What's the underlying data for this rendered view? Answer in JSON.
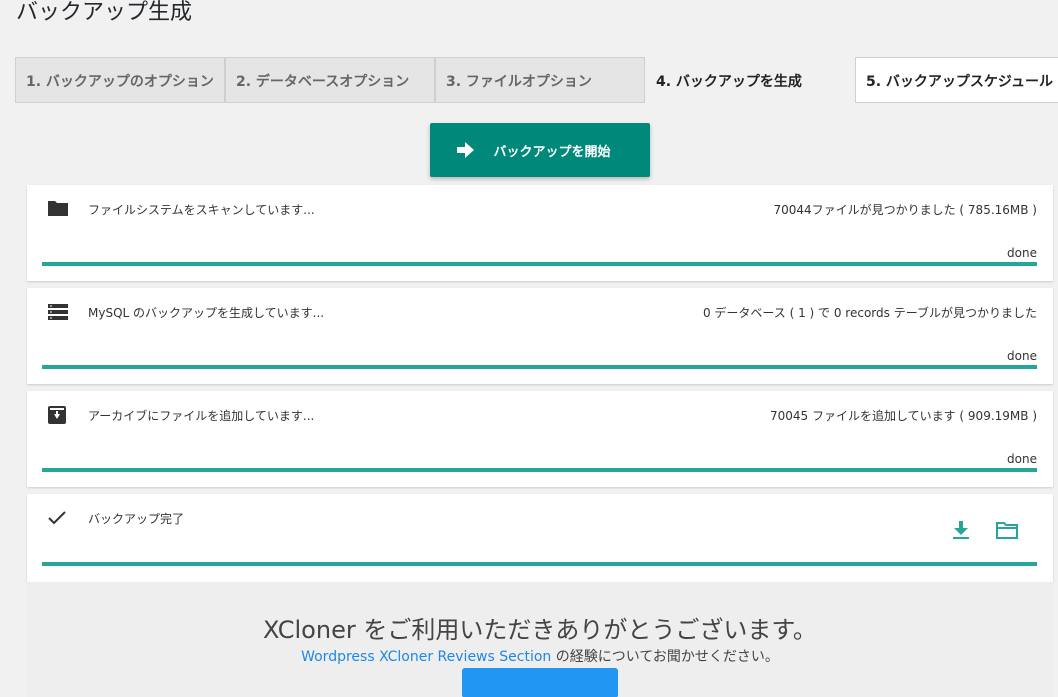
{
  "page": {
    "title": "バックアップ生成"
  },
  "tabs": [
    {
      "label": "1. バックアップのオプション"
    },
    {
      "label": "2. データベースオプション"
    },
    {
      "label": "3. ファイルオプション"
    },
    {
      "label": "4. バックアップを生成"
    },
    {
      "label": "5. バックアップスケジュール"
    }
  ],
  "start_button": {
    "label": "バックアップを開始",
    "icon": "arrow-right-icon"
  },
  "steps": [
    {
      "icon": "folder-icon",
      "label": "ファイルシステムをスキャンしています...",
      "status": "70044ファイルが見つかりました ( 785.16MB )",
      "done": "done",
      "progress": 1.0
    },
    {
      "icon": "database-list-icon",
      "label": "MySQL のバックアップを生成しています...",
      "status": "0 データベース ( 1 ) で 0 records テーブルが見つかりました",
      "done": "done",
      "progress": 1.0
    },
    {
      "icon": "archive-icon",
      "label": "アーカイブにファイルを追加しています...",
      "status": "70045 ファイルを追加しています ( 909.19MB )",
      "done": "done",
      "progress": 1.0
    },
    {
      "icon": "check-icon",
      "label": "バックアップ完了",
      "progress": 1.0,
      "actions": [
        "download-icon",
        "folder-open-icon"
      ]
    }
  ],
  "thanks": {
    "title": "XCloner をご利用いただきありがとうございます。",
    "link_text": "Wordpress XCloner Reviews Section",
    "line_suffix": " の経験についてお聞かせください。"
  },
  "colors": {
    "accent": "#00897b",
    "progress": "#26a69a",
    "link": "#1e88e5"
  }
}
